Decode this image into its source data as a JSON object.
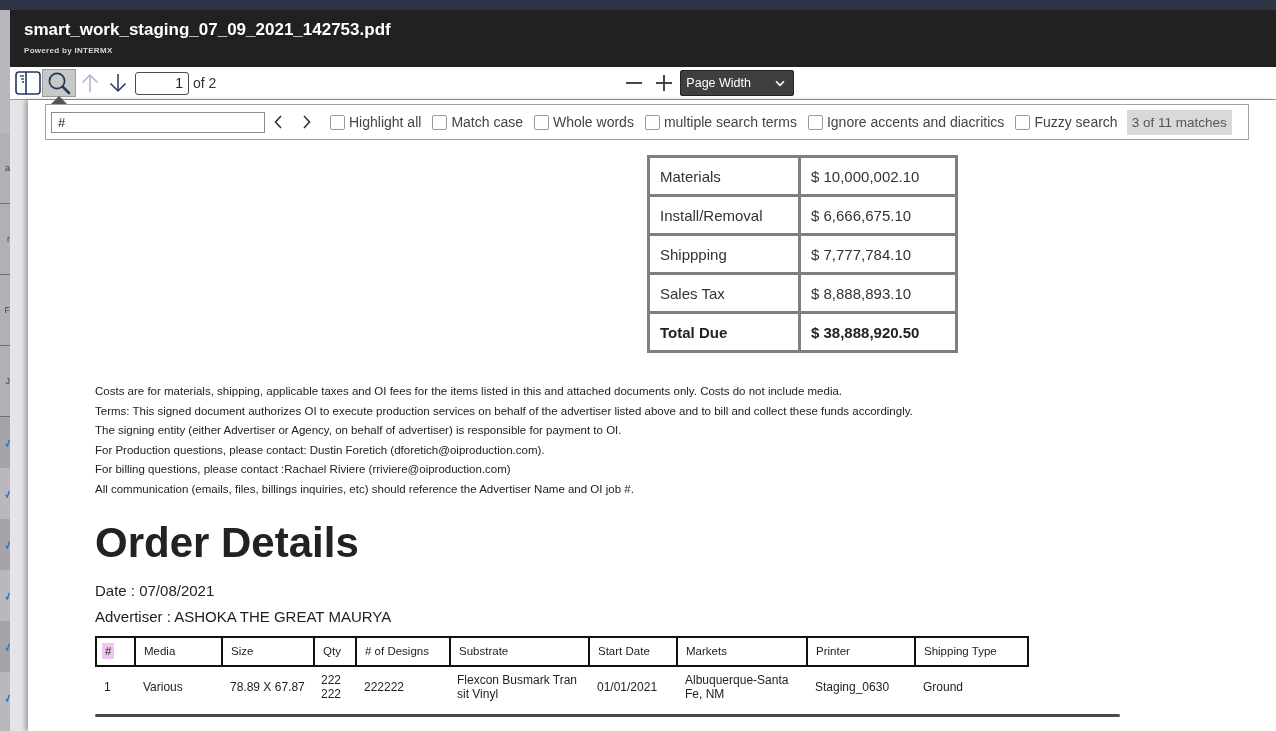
{
  "background_app": {
    "rows": [
      {
        "kind": "text",
        "text": "a"
      },
      {
        "kind": "text",
        "text": "r"
      },
      {
        "kind": "text",
        "text": "F"
      },
      {
        "kind": "text",
        "text": "J"
      },
      {
        "kind": "check"
      },
      {
        "kind": "check"
      },
      {
        "kind": "check"
      },
      {
        "kind": "check"
      },
      {
        "kind": "check"
      },
      {
        "kind": "check"
      }
    ]
  },
  "viewer": {
    "title": "smart_work_staging_07_09_2021_142753.pdf",
    "subtitle": "Powered by INTERMX",
    "toolbar": {
      "sidebar_toggle": {
        "selected": false
      },
      "find": {
        "selected": true
      },
      "previous_page": {
        "disabled": true
      },
      "next_page": {
        "disabled": false
      },
      "page_number": "1",
      "page_count": "of 2",
      "zoom_select": "Page Width"
    },
    "find_bar": {
      "query": "#",
      "options": [
        {
          "label": "Highlight all",
          "checked": false
        },
        {
          "label": "Match case",
          "checked": false
        },
        {
          "label": "Whole words",
          "checked": false
        },
        {
          "label": "multiple search terms",
          "checked": false
        },
        {
          "label": "Ignore accents and diacritics",
          "checked": false
        },
        {
          "label": "Fuzzy search",
          "checked": false
        }
      ],
      "result": "3 of 11 matches"
    }
  },
  "document": {
    "totals": [
      {
        "kind": "line",
        "label": "Materials",
        "value": "$ 10,000,002.10"
      },
      {
        "kind": "line",
        "label": "Install/Removal",
        "value": "$ 6,666,675.10"
      },
      {
        "kind": "line",
        "label": "Shippping",
        "value": "$ 7,777,784.10"
      },
      {
        "kind": "line",
        "label": "Sales Tax",
        "value": "$ 8,888,893.10"
      },
      {
        "kind": "total",
        "label": "Total Due",
        "value": "$ 38,888,920.50"
      }
    ],
    "notes": [
      "Costs are for materials, shipping, applicable taxes and OI fees for the items listed in this and attached documents only. Costs do not include media.",
      "Terms: This signed document authorizes OI to execute production services on behalf of the advertiser listed above and to bill and collect these funds accordingly.",
      "The signing entity (either Advertiser or Agency, on behalf of advertiser) is responsible for payment to OI.",
      "For Production questions, please contact: Dustin Foretich (dforetich@oiproduction.com).",
      "For billing questions, please contact :Rachael Riviere (rriviere@oiproduction.com)",
      "All communication (emails, files, billings inquiries, etc) should reference the Advertiser Name and OI job #."
    ],
    "heading": "Order Details",
    "fields": [
      "Date : 07/08/2021",
      "Advertiser : ASHOKA THE GREAT MAURYA"
    ],
    "order_table": {
      "columns": [
        {
          "label": "#",
          "highlighted": true
        },
        {
          "label": "Media",
          "highlighted": false
        },
        {
          "label": "Size",
          "highlighted": false
        },
        {
          "label": "Qty",
          "highlighted": false
        },
        {
          "label": "# of Designs",
          "highlighted": false
        },
        {
          "label": "Substrate",
          "highlighted": false
        },
        {
          "label": "Start Date",
          "highlighted": false
        },
        {
          "label": "Markets",
          "highlighted": false
        },
        {
          "label": "Printer",
          "highlighted": false
        },
        {
          "label": "Shipping Type",
          "highlighted": false
        }
      ],
      "rows": [
        [
          "1",
          "Various",
          "78.89 X 67.87",
          "222222",
          "222222",
          "Flexcon Busmark Transit Vinyl",
          "01/01/2021",
          "Albuquerque-Santa Fe, NM",
          "Staging_0630",
          "Ground"
        ]
      ]
    }
  }
}
